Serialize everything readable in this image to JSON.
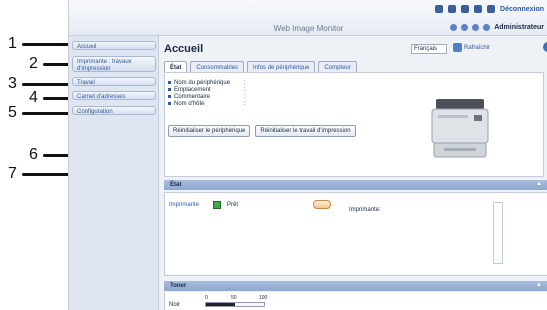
{
  "callouts": [
    "1",
    "2",
    "3",
    "4",
    "5",
    "6",
    "7"
  ],
  "header": {
    "brand": "Web Image Monitor",
    "logout_label": "Déconnexion",
    "user_label": "Administrateur"
  },
  "sidebar": {
    "items": [
      {
        "label": "Accueil"
      },
      {
        "label": "Imprimante : travaux d'impression"
      },
      {
        "label": "Travail"
      },
      {
        "label": "Carnet d'adresses"
      },
      {
        "label": "Configuration"
      }
    ]
  },
  "main": {
    "title": "Accueil",
    "language": "Français",
    "refresh_label": "Rafraîchir",
    "tabs": [
      {
        "label": "État"
      },
      {
        "label": "Consommables"
      },
      {
        "label": "Infos de périphérique"
      },
      {
        "label": "Compteur"
      }
    ],
    "info_fields": [
      {
        "label": "Nom du périphérique",
        "value": ":"
      },
      {
        "label": "Emplacement",
        "value": ":"
      },
      {
        "label": "Commentaire",
        "value": ":"
      },
      {
        "label": "Nom d'hôte",
        "value": ":"
      }
    ],
    "buttons": {
      "reset_device": "Réinitialiser le périphérique",
      "reset_print_job": "Réinitialiser le travail d'impression"
    }
  },
  "status_section": {
    "title": "État",
    "device_label": "Imprimante",
    "device_status": "Prêt",
    "printer_label": "Imprimante:"
  },
  "toner_section": {
    "title": "Toner",
    "color_label": "Noir",
    "scale": [
      "0",
      "50",
      "100"
    ],
    "level_fraction": 0.5
  },
  "colors": {
    "accent": "#2e5aa8",
    "section_bar": "#8ea8cf",
    "ready": "#3ea84a"
  }
}
